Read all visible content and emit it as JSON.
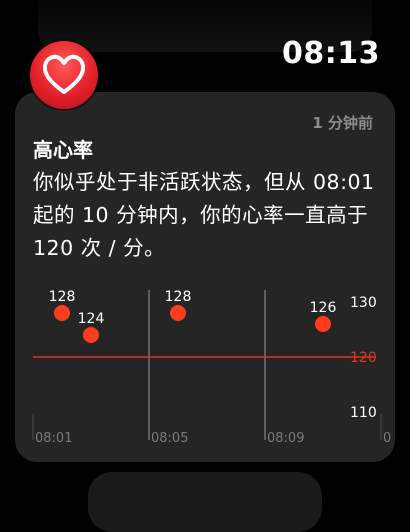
{
  "status_bar": {
    "time": "08:13"
  },
  "app": {
    "icon": "heart-icon",
    "accent_color": "#e3202a"
  },
  "notification": {
    "time_ago": "1 分钟前",
    "title": "高心率",
    "message": "你似乎处于非活跃状态，但从 08:01 起的 10 分钟内，你的心率一直高于 120 次 / 分。"
  },
  "chart_data": {
    "type": "scatter",
    "x": [
      "08:02",
      "08:03",
      "08:06",
      "08:11"
    ],
    "values": [
      128,
      124,
      128,
      126
    ],
    "point_labels": [
      "128",
      "124",
      "128",
      "126"
    ],
    "x_tick_labels": [
      "08:01",
      "08:05",
      "08:09"
    ],
    "y_tick_labels": [
      "130",
      "120",
      "110"
    ],
    "ylim": [
      110,
      130
    ],
    "threshold": 120,
    "point_color": "#ff3b20",
    "threshold_color": "#d63a22"
  }
}
